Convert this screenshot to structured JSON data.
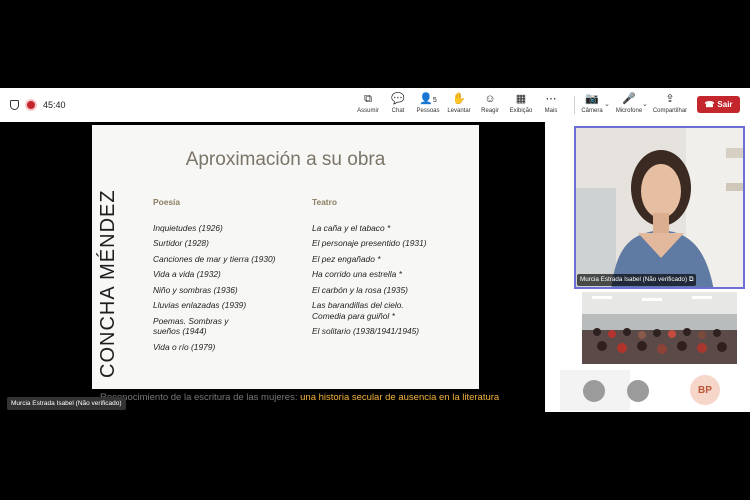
{
  "meeting": {
    "timer": "45:40",
    "toolbar": [
      {
        "key": "assumir",
        "label": "Assumir",
        "icon": "screen-share-icon",
        "glyph": "⧉"
      },
      {
        "key": "chat",
        "label": "Chat",
        "icon": "chat-icon",
        "glyph": "💬"
      },
      {
        "key": "pessoas",
        "label": "Pessoas",
        "icon": "people-icon",
        "glyph": "👤",
        "badge": "5"
      },
      {
        "key": "levantar",
        "label": "Levantar",
        "icon": "raise-hand-icon",
        "glyph": "✋"
      },
      {
        "key": "reagir",
        "label": "Reagir",
        "icon": "smiley-icon",
        "glyph": "☺"
      },
      {
        "key": "exibicao",
        "label": "Exibição",
        "icon": "grid-icon",
        "glyph": "▦"
      },
      {
        "key": "mais",
        "label": "Mais",
        "icon": "more-icon",
        "glyph": "⋯"
      },
      {
        "key": "camera",
        "label": "Câmera",
        "icon": "camera-off-icon",
        "glyph": "📷"
      },
      {
        "key": "microfone",
        "label": "Microfone",
        "icon": "mic-off-icon",
        "glyph": "🎤"
      },
      {
        "key": "compartilhar",
        "label": "Compartilhar",
        "icon": "share-icon",
        "glyph": "⇪"
      }
    ],
    "leave_label": "Sair",
    "accent": "#c4262e"
  },
  "slide": {
    "title": "Aproximación a su obra",
    "author": "CONCHA MÉNDEZ",
    "poesia_header": "Poesía",
    "poesia": [
      "Inquietudes (1926)",
      "Surtidor (1928)",
      "Canciones de mar y tierra (1930)",
      "Vida a vida (1932)",
      "Niño y sombras (1936)",
      "Lluvias enlazadas (1939)",
      "Poemas. Sombras y sueños (1944)",
      "Vida o río (1979)"
    ],
    "teatro_header": "Teatro",
    "teatro": [
      "La caña y el tabaco *",
      "El personaje presentido (1931)",
      "El pez engañado *",
      "Ha corrido una estrella *",
      "El carbón y la rosa (1935)",
      "Las barandillas del cielo. Comedia para guiñol *",
      "El solitario (1938/1941/1945)"
    ]
  },
  "caption": {
    "part1": "Reconocimiento de la escritura de las mujeres:",
    "part2": " una historia secular de ausencia en la literatura"
  },
  "presenter_label": "Murcia Estrada Isabel (Não verificado)",
  "participant_label": "Murcia Estrada Isabel (Não verificado)",
  "participant_initials": "BP"
}
